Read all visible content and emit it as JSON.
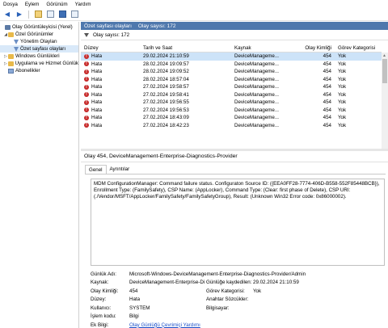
{
  "menu": [
    "Dosya",
    "Eylem",
    "Görünüm",
    "Yardım"
  ],
  "tree": {
    "items": [
      {
        "label": "Olay Görüntüleyicisi (Yerel)",
        "icon": "computer-icon",
        "indent": 0
      },
      {
        "label": "Özel Görünümler",
        "icon": "folder-icon",
        "indent": 1
      },
      {
        "label": "Yönetim Olayları",
        "icon": "filter-icon",
        "indent": 2
      },
      {
        "label": "Özet sayfası olayları",
        "icon": "filter-icon",
        "indent": 2
      },
      {
        "label": "Windows Günlükleri",
        "icon": "folder-icon",
        "indent": 1
      },
      {
        "label": "Uygulama ve Hizmet Günlük",
        "icon": "folder-icon",
        "indent": 1
      },
      {
        "label": "Abonelikler",
        "icon": "log-icon",
        "indent": 1
      }
    ]
  },
  "pane": {
    "title": "Özet sayfası olayları",
    "count": "Olay sayısı: 172",
    "filter_count": "Olay sayısı: 172"
  },
  "table": {
    "headers": [
      "Düzey",
      "Tarih ve Saat",
      "Kaynak",
      "Olay Kimliği",
      "Görev Kategorisi"
    ],
    "rows": [
      {
        "level": "Hata",
        "date": "29.02.2024 21:10:59",
        "source": "DeviceManageme...",
        "id": "454",
        "category": "Yok"
      },
      {
        "level": "Hata",
        "date": "28.02.2024 19:09:57",
        "source": "DeviceManageme...",
        "id": "454",
        "category": "Yok"
      },
      {
        "level": "Hata",
        "date": "28.02.2024 19:09:52",
        "source": "DeviceManageme...",
        "id": "454",
        "category": "Yok"
      },
      {
        "level": "Hata",
        "date": "28.02.2024 18:57:04",
        "source": "DeviceManageme...",
        "id": "454",
        "category": "Yok"
      },
      {
        "level": "Hata",
        "date": "27.02.2024 19:58:57",
        "source": "DeviceManageme...",
        "id": "454",
        "category": "Yok"
      },
      {
        "level": "Hata",
        "date": "27.02.2024 19:58:41",
        "source": "DeviceManageme...",
        "id": "454",
        "category": "Yok"
      },
      {
        "level": "Hata",
        "date": "27.02.2024 19:56:55",
        "source": "DeviceManageme...",
        "id": "454",
        "category": "Yok"
      },
      {
        "level": "Hata",
        "date": "27.02.2024 19:56:53",
        "source": "DeviceManageme...",
        "id": "454",
        "category": "Yok"
      },
      {
        "level": "Hata",
        "date": "27.02.2024 18:43:09",
        "source": "DeviceManageme...",
        "id": "454",
        "category": "Yok"
      },
      {
        "level": "Hata",
        "date": "27.02.2024 18:42:23",
        "source": "DeviceManageme...",
        "id": "454",
        "category": "Yok"
      }
    ]
  },
  "detail": {
    "title": "Olay 454, DeviceManagement-Enterprise-Diagnostics-Provider",
    "tabs": [
      "Genel",
      "Ayrıntılar"
    ],
    "message": "MDM ConfigurationManager: Command failure status. Configuraton Source ID: ({EEA0FF28-7774-406D-B558-552F85448BCB}), Enrollment Type: (FamilySafety), CSP Name: (AppLocker), Command Type: (Clear: first phase of Delete), CSP URI: (./Vendor/MSFT/AppLocker/FamilySafety/FamilySafetyGroup), Result: (Unknown Win32 Error code: 0x86000002).",
    "props": {
      "log_name_label": "Günlük Adı:",
      "log_name": "Microsoft-Windows-DeviceManagement-Enterprise-Diagnostics-Provider/Admin",
      "source_label": "Kaynak:",
      "source": "DeviceManagement-Enterprise-Di",
      "logged_label": "Günlüğe kaydedilen:",
      "logged": "29.02.2024 21:10:59",
      "event_id_label": "Olay Kimliği:",
      "event_id": "454",
      "task_label": "Görev Kategorisi:",
      "task": "Yok",
      "level_label": "Düzey:",
      "level": "Hata",
      "keywords_label": "Anahtar Sözcükler:",
      "keywords": "",
      "user_label": "Kullanıcı:",
      "user": "SYSTEM",
      "computer_label": "Bilgisayar:",
      "computer": "",
      "opcode_label": "İşlem kodu:",
      "opcode": "Bilgi",
      "more_label": "Ek Bilgi:",
      "more_link": "Olay Günlüğü Çevrimiçi Yardımı"
    }
  },
  "colors": {
    "pane_header": "#4f78ad",
    "selection": "#cde3f8",
    "error": "#c62828",
    "link": "#1a4fc9"
  }
}
